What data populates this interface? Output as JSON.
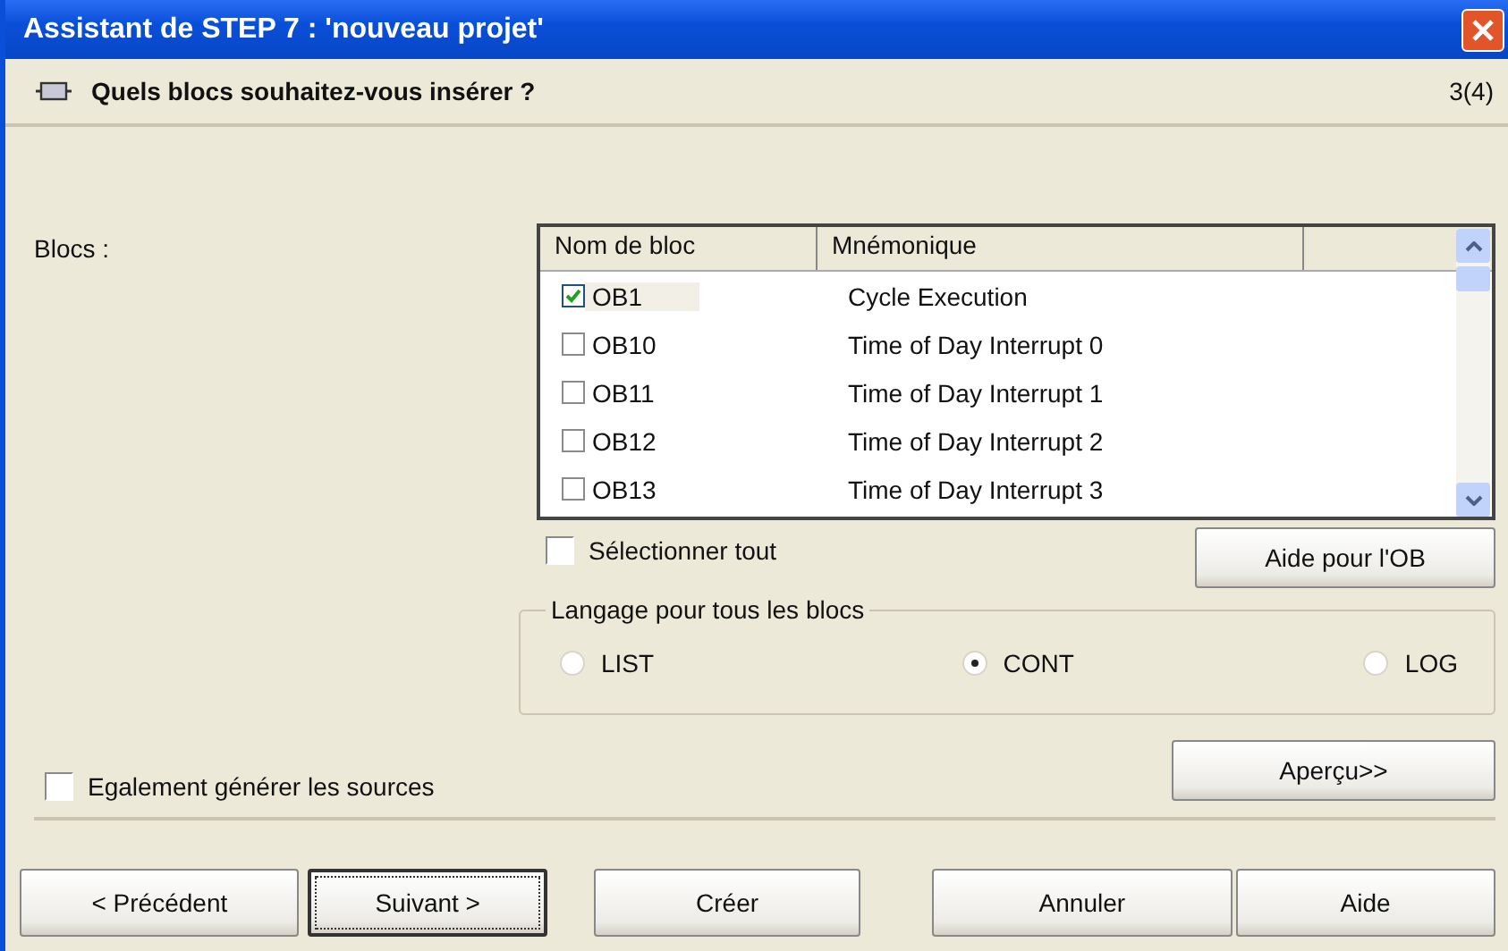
{
  "window": {
    "title": "Assistant de STEP 7 : 'nouveau projet'"
  },
  "header": {
    "question": "Quels blocs souhaitez-vous insérer ?",
    "step": "3(4)"
  },
  "blocks_label": "Blocs :",
  "table": {
    "columns": [
      "Nom de bloc",
      "Mnémonique"
    ],
    "rows": [
      {
        "name": "OB1",
        "mnemonic": "Cycle Execution",
        "checked": true
      },
      {
        "name": "OB10",
        "mnemonic": "Time of Day Interrupt 0",
        "checked": false
      },
      {
        "name": "OB11",
        "mnemonic": "Time of Day Interrupt 1",
        "checked": false
      },
      {
        "name": "OB12",
        "mnemonic": "Time of Day Interrupt 2",
        "checked": false
      },
      {
        "name": "OB13",
        "mnemonic": "Time of Day Interrupt 3",
        "checked": false
      }
    ]
  },
  "select_all": {
    "label": "Sélectionner tout",
    "checked": false
  },
  "ob_help_button": "Aide pour l'OB",
  "language_group": {
    "title": "Langage pour tous les blocs",
    "options": [
      {
        "label": "LIST",
        "selected": false
      },
      {
        "label": "CONT",
        "selected": true
      },
      {
        "label": "LOG",
        "selected": false
      }
    ]
  },
  "generate_sources": {
    "label": "Egalement générer les sources",
    "checked": false
  },
  "preview_button": "Aperçu>>",
  "buttons": [
    {
      "label": "< Précédent",
      "default": false
    },
    {
      "label": "Suivant >",
      "default": true
    },
    {
      "label": "Créer",
      "default": false
    },
    {
      "label": "Annuler",
      "default": false
    },
    {
      "label": "Aide",
      "default": false
    }
  ]
}
